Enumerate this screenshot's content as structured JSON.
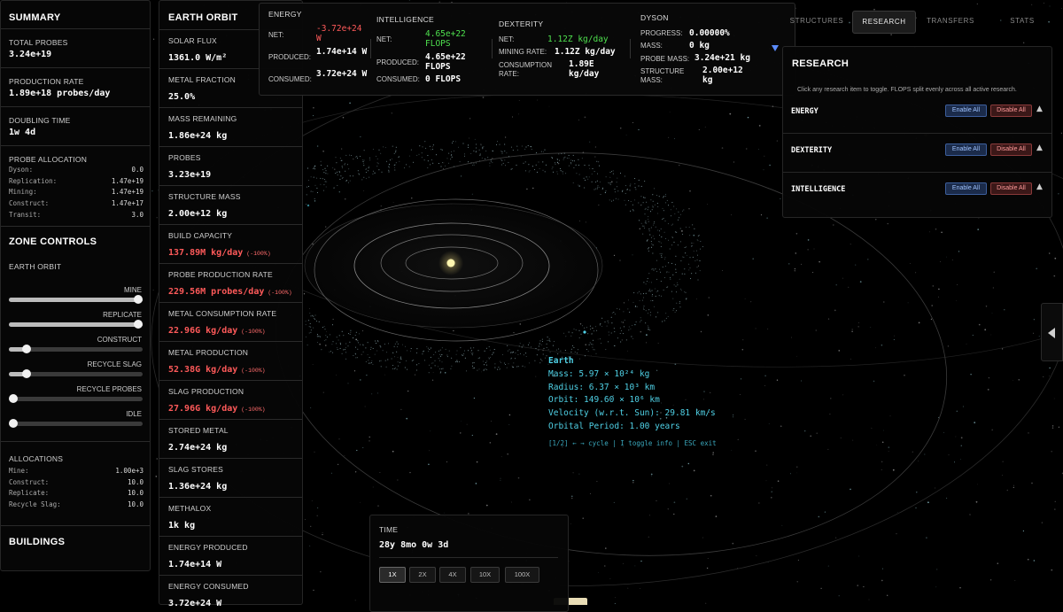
{
  "summary": {
    "title": "SUMMARY",
    "total_probes_label": "TOTAL PROBES",
    "total_probes": "3.24e+19",
    "production_rate_label": "PRODUCTION RATE",
    "production_rate": "1.89e+18 probes/day",
    "doubling_label": "DOUBLING TIME",
    "doubling": "1w 4d",
    "probe_alloc_label": "PROBE ALLOCATION",
    "probe_alloc": [
      {
        "k": "Dyson:",
        "v": "0.0"
      },
      {
        "k": "Replication:",
        "v": "1.47e+19"
      },
      {
        "k": "Mining:",
        "v": "1.47e+19"
      },
      {
        "k": "Construct:",
        "v": "1.47e+17"
      },
      {
        "k": "Transit:",
        "v": "3.0"
      }
    ]
  },
  "zone_controls": {
    "title": "ZONE CONTROLS",
    "zone_name": "EARTH ORBIT",
    "sliders": [
      {
        "label": "MINE",
        "value": 1.0
      },
      {
        "label": "REPLICATE",
        "value": 1.0
      },
      {
        "label": "CONSTRUCT",
        "value": 0.13
      },
      {
        "label": "RECYCLE SLAG",
        "value": 0.13
      },
      {
        "label": "RECYCLE PROBES",
        "value": 0.0
      },
      {
        "label": "IDLE",
        "value": 0.0
      }
    ],
    "allocations_label": "ALLOCATIONS",
    "allocations": [
      {
        "k": "Mine:",
        "v": "1.00e+3"
      },
      {
        "k": "Construct:",
        "v": "10.0"
      },
      {
        "k": "Replicate:",
        "v": "10.0"
      },
      {
        "k": "Recycle Slag:",
        "v": "10.0"
      }
    ],
    "buildings_label": "BUILDINGS"
  },
  "orbit": {
    "title": "EARTH ORBIT",
    "stats": [
      {
        "label": "SOLAR FLUX",
        "value": "1361.0 W/m²",
        "red": false,
        "note": ""
      },
      {
        "label": "METAL FRACTION",
        "value": "25.0%",
        "red": false,
        "note": ""
      },
      {
        "label": "MASS REMAINING",
        "value": "1.86e+24 kg",
        "red": false,
        "note": ""
      },
      {
        "label": "PROBES",
        "value": "3.23e+19",
        "red": false,
        "note": ""
      },
      {
        "label": "STRUCTURE MASS",
        "value": "2.00e+12 kg",
        "red": false,
        "note": ""
      },
      {
        "label": "BUILD CAPACITY",
        "value": "137.89M kg/day",
        "red": true,
        "note": "(-100%)"
      },
      {
        "label": "PROBE PRODUCTION RATE",
        "value": "229.56M probes/day",
        "red": true,
        "note": "(-100%)"
      },
      {
        "label": "METAL CONSUMPTION RATE",
        "value": "22.96G kg/day",
        "red": true,
        "note": "(-100%)"
      },
      {
        "label": "METAL PRODUCTION",
        "value": "52.38G kg/day",
        "red": true,
        "note": "(-100%)"
      },
      {
        "label": "SLAG PRODUCTION",
        "value": "27.96G kg/day",
        "red": true,
        "note": "(-100%)"
      },
      {
        "label": "STORED METAL",
        "value": "2.74e+24 kg",
        "red": false,
        "note": ""
      },
      {
        "label": "SLAG STORES",
        "value": "1.36e+24 kg",
        "red": false,
        "note": ""
      },
      {
        "label": "METHALOX",
        "value": "1k kg",
        "red": false,
        "note": ""
      },
      {
        "label": "ENERGY PRODUCED",
        "value": "1.74e+14 W",
        "red": false,
        "note": ""
      },
      {
        "label": "ENERGY CONSUMED",
        "value": "3.72e+24 W",
        "red": false,
        "note": ""
      }
    ]
  },
  "topbar": {
    "energy": {
      "title": "ENERGY",
      "net_label": "NET:",
      "net": "-3.72e+24 W",
      "produced_label": "PRODUCED:",
      "produced": "1.74e+14 W",
      "consumed_label": "CONSUMED:",
      "consumed": "3.72e+24 W"
    },
    "intelligence": {
      "title": "INTELLIGENCE",
      "net_label": "NET:",
      "net": "4.65e+22 FLOPS",
      "produced_label": "PRODUCED:",
      "produced": "4.65e+22 FLOPS",
      "consumed_label": "CONSUMED:",
      "consumed": "0 FLOPS"
    },
    "dexterity": {
      "title": "DEXTERITY",
      "net_label": "NET:",
      "net": "1.12Z kg/day",
      "mining_label": "MINING RATE:",
      "mining": "1.12Z kg/day",
      "consumption_label": "CONSUMPTION RATE:",
      "consumption": "1.89E kg/day"
    },
    "dyson": {
      "title": "DYSON",
      "progress_label": "PROGRESS:",
      "progress": "0.00000%",
      "mass_label": "MASS:",
      "mass": "0 kg",
      "probe_mass_label": "PROBE MASS:",
      "probe_mass": "3.24e+21 kg",
      "structure_mass_label": "STRUCTURE MASS:",
      "structure_mass": "2.00e+12 kg"
    },
    "dropdown_icon": "triangle-down"
  },
  "tabs": [
    {
      "label": "STRUCTURES",
      "active": false
    },
    {
      "label": "RESEARCH",
      "active": true
    },
    {
      "label": "TRANSFERS",
      "active": false
    },
    {
      "label": "STATS",
      "active": false
    }
  ],
  "research": {
    "title": "RESEARCH",
    "hint": "Click any research item to toggle. FLOPS split evenly across all active research.",
    "items": [
      {
        "name": "ENERGY",
        "enable": "Enable All",
        "disable": "Disable All"
      },
      {
        "name": "DEXTERITY",
        "enable": "Enable All",
        "disable": "Disable All"
      },
      {
        "name": "INTELLIGENCE",
        "enable": "Enable All",
        "disable": "Disable All"
      }
    ]
  },
  "info": {
    "name": "Earth",
    "mass": "Mass: 5.97 × 10²⁴ kg",
    "radius": "Radius: 6.37 × 10³ km",
    "orbit": "Orbit: 149.60 × 10⁶ km",
    "velocity": "Velocity (w.r.t. Sun): 29.81 km/s",
    "period": "Orbital Period: 1.00 years",
    "help": "[1/2] ← → cycle | I toggle info | ESC exit"
  },
  "time": {
    "label": "TIME",
    "value": "28y 8mo 0w 3d",
    "speeds": [
      {
        "label": "1X",
        "active": true
      },
      {
        "label": "2X",
        "active": false
      },
      {
        "label": "4X",
        "active": false
      },
      {
        "label": "10X",
        "active": false
      },
      {
        "label": "100X",
        "active": false
      }
    ]
  },
  "colors": {
    "accent_cyan": "#4fd1e6",
    "negative": "#ff5a5a",
    "positive": "#4ee04e",
    "sun": "#fff6b0"
  }
}
